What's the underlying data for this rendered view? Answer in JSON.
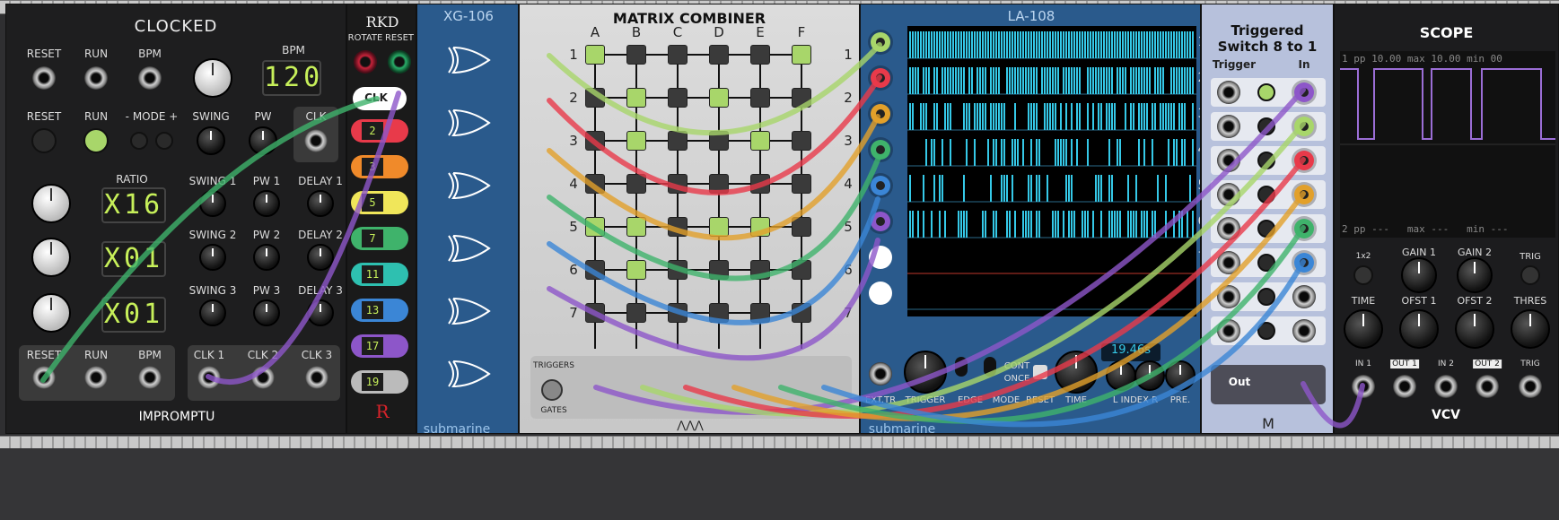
{
  "clocked": {
    "title": "CLOCKED",
    "row1": {
      "reset": "RESET",
      "run": "RUN",
      "bpm": "BPM",
      "bpm_display_label": "BPM",
      "bpm_value": "120"
    },
    "row2": {
      "reset": "RESET",
      "run": "RUN",
      "mode": "- MODE +",
      "swing": "SWING",
      "pw": "PW",
      "clk": "CLK"
    },
    "ratio": "RATIO",
    "ratios": [
      {
        "value": "X16",
        "swing": "SWING 1",
        "pw": "PW 1",
        "delay": "DELAY 1"
      },
      {
        "value": "X01",
        "swing": "SWING 2",
        "pw": "PW 2",
        "delay": "DELAY 2"
      },
      {
        "value": "X01",
        "swing": "SWING 3",
        "pw": "PW 3",
        "delay": "DELAY 3"
      }
    ],
    "outputs": {
      "reset": "RESET",
      "run": "RUN",
      "bpm": "BPM",
      "clk1": "CLK 1",
      "clk2": "CLK 2",
      "clk3": "CLK 3"
    },
    "brand": "IMPROMPTU"
  },
  "rkd": {
    "title": "RKD",
    "rotate": "ROTATE",
    "reset": "RESET",
    "clk": "CLK",
    "channels": [
      "2",
      "3",
      "5",
      "7",
      "11",
      "13",
      "17",
      "19"
    ]
  },
  "xg106": {
    "title": "XG-106",
    "brand": "submarine"
  },
  "matrix": {
    "title": "MATRIX COMBINER",
    "cols": [
      "A",
      "B",
      "C",
      "D",
      "E",
      "F"
    ],
    "rows": [
      "1",
      "2",
      "3",
      "4",
      "5",
      "6",
      "7"
    ],
    "grid": [
      [
        1,
        0,
        0,
        0,
        0,
        1
      ],
      [
        0,
        1,
        0,
        1,
        0,
        0
      ],
      [
        0,
        1,
        0,
        0,
        1,
        0
      ],
      [
        0,
        0,
        0,
        0,
        0,
        0
      ],
      [
        1,
        1,
        0,
        1,
        1,
        0
      ],
      [
        0,
        1,
        0,
        0,
        0,
        0
      ],
      [
        0,
        0,
        0,
        0,
        0,
        0
      ]
    ],
    "triggers": "TRIGGERS",
    "gates": "GATES"
  },
  "la108": {
    "title": "LA-108",
    "brand": "submarine",
    "row_numbers": [
      "1",
      "2",
      "3",
      "4",
      "5",
      "6",
      "7"
    ],
    "time_display": "19.46s",
    "labels": {
      "ext_tr": "EXT.TR",
      "trigger": "TRIGGER",
      "edge": "EDGE",
      "mode": "MODE",
      "reset": "RESET",
      "time": "TIME",
      "cont": "CONT",
      "once": "ONCE",
      "index": "L INDEX R",
      "pre": "PRE."
    }
  },
  "tswitch": {
    "title": "Triggered Switch 8 to 1",
    "col_trigger": "Trigger",
    "col_in": "In",
    "out": "Out"
  },
  "scope": {
    "title": "SCOPE",
    "ch1": {
      "num": "1",
      "pp": "pp",
      "pp_val": "10.00",
      "max": "max",
      "max_val": "10.00",
      "min": "min",
      "min_val": "00"
    },
    "ch2": {
      "num": "2",
      "pp": "pp",
      "pp_val": "---",
      "max": "max",
      "max_val": "---",
      "min": "min",
      "min_val": "---"
    },
    "controls": {
      "x2": "1x2",
      "gain1": "GAIN 1",
      "gain2": "GAIN 2",
      "trig": "TRIG",
      "time": "TIME",
      "ofst1": "OFST 1",
      "ofst2": "OFST 2",
      "thres": "THRES",
      "in1": "IN 1",
      "out1": "OUT 1",
      "in2": "IN 2",
      "out2": "OUT 2",
      "trig2": "TRIG"
    },
    "brand": "VCV"
  },
  "colors": {
    "green_led": "#a8d66a",
    "scope_trace": "#9b6ed6",
    "analyzer": "#35c9e8",
    "panel_blue": "#2a5a8c"
  }
}
